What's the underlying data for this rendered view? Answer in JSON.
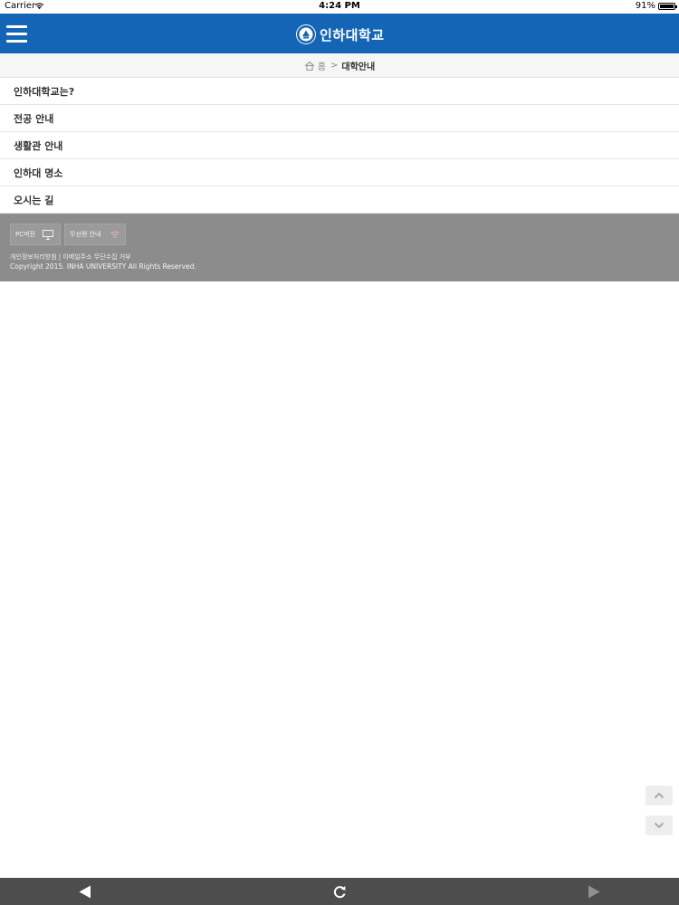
{
  "status_bar": {
    "carrier": "Carrier",
    "time": "4:24 PM",
    "battery": "91%"
  },
  "header": {
    "logo_text": "인하대학교",
    "color": "#1565b7"
  },
  "breadcrumb": {
    "home": "홈",
    "separator": ">",
    "current": "대학안내"
  },
  "menu": {
    "items": [
      {
        "label": "인하대학교는?"
      },
      {
        "label": "전공 안내"
      },
      {
        "label": "생활관 안내"
      },
      {
        "label": "인하대 명소"
      },
      {
        "label": "오시는 길"
      }
    ]
  },
  "footer": {
    "pc_button": "PC버전",
    "wifi_button": "무선랜 안내",
    "links": "개인정보처리방침 | 이메일주소 무단수집 거부",
    "copyright": "Copyright 2015. INHA UNIVERSITY All Rights Reserved."
  },
  "icons": {
    "menu": "hamburger-icon",
    "home": "home-icon",
    "pc": "monitor-icon",
    "wifi": "wifi-icon",
    "scroll_up": "chevron-up-icon",
    "scroll_down": "chevron-down-icon",
    "back": "back-arrow-icon",
    "reload": "reload-icon",
    "forward": "forward-arrow-icon"
  }
}
